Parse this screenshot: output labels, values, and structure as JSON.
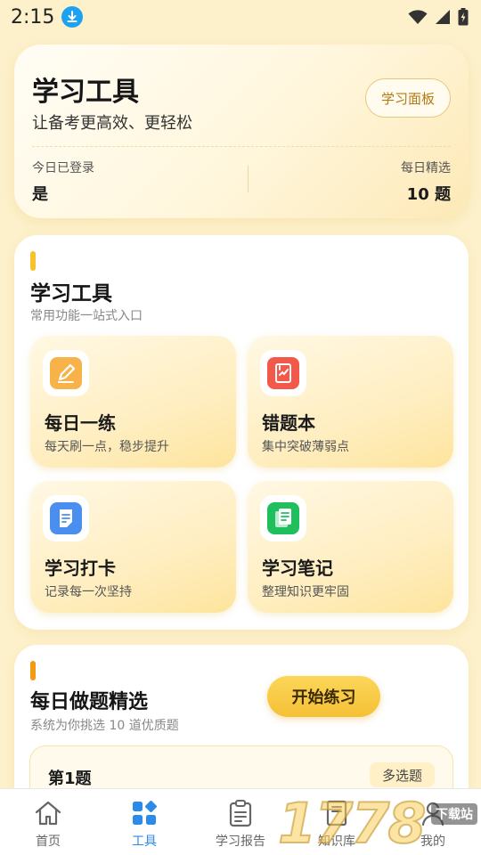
{
  "status_bar": {
    "time": "2:15"
  },
  "header": {
    "title": "学习工具",
    "subtitle": "让备考更高效、更轻松",
    "panel_button": "学习面板",
    "stats": [
      {
        "label": "今日已登录",
        "value": "是"
      },
      {
        "label": "每日精选",
        "value": "10 题"
      }
    ]
  },
  "tools": {
    "title": "学习工具",
    "subtitle": "常用功能一站式入口",
    "items": [
      {
        "title": "每日一练",
        "desc": "每天刷一点，稳步提升",
        "icon": "pencil-icon",
        "color": "#f7b34a"
      },
      {
        "title": "错题本",
        "desc": "集中突破薄弱点",
        "icon": "wrong-book-icon",
        "color": "#f2594a"
      },
      {
        "title": "学习打卡",
        "desc": "记录每一次坚持",
        "icon": "checkin-doc-icon",
        "color": "#4a8ef0"
      },
      {
        "title": "学习笔记",
        "desc": "整理知识更牢固",
        "icon": "notes-icon",
        "color": "#1fbf5e"
      }
    ]
  },
  "daily": {
    "title": "每日做题精选",
    "subtitle": "系统为你挑选 10 道优质题",
    "start_button": "开始练习",
    "question": {
      "number": "第1题",
      "type": "多选题"
    }
  },
  "bottom_nav": {
    "items": [
      {
        "label": "首页",
        "icon": "home-icon"
      },
      {
        "label": "工具",
        "icon": "tools-grid-icon",
        "active": true
      },
      {
        "label": "学习报告",
        "icon": "report-clipboard-icon"
      },
      {
        "label": "知识库",
        "icon": "knowledge-book-icon"
      },
      {
        "label": "我的",
        "icon": "profile-icon"
      }
    ]
  },
  "watermark": {
    "text": "1778",
    "tag": "下载站"
  },
  "colors": {
    "accent": "#f6c22d",
    "active_nav": "#2c8be8",
    "background": "#fdf1cc"
  }
}
